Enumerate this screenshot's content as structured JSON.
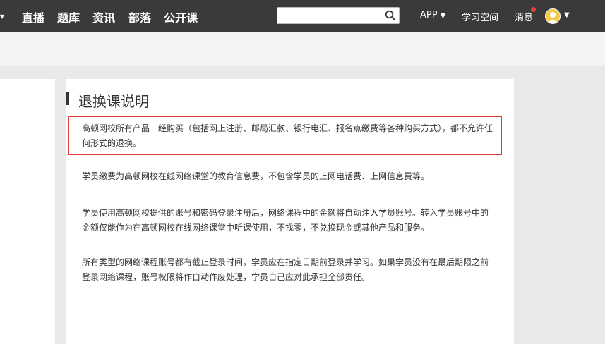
{
  "nav": {
    "items": [
      "直播",
      "题库",
      "资讯",
      "部落",
      "公开课"
    ],
    "search_placeholder": "",
    "app_label": "APP",
    "study_space_label": "学习空间",
    "messages_label": "消息"
  },
  "article": {
    "title": "退换课说明",
    "paragraphs": [
      "高顿网校所有产品一经购买（包括网上注册、邮局汇款、银行电汇、报名点缴费等各种购买方式），都不允许任何形式的退换。",
      "学员缴费为高顿网校在线网络课堂的教育信息费，不包含学员的上网电话费、上网信息费等。",
      "学员使用高顿网校提供的账号和密码登录注册后，网络课程中的金额将自动注入学员账号。转入学员账号中的金额仅能作为在高顿网校在线网络课堂中听课使用，不找零，不兑换现金或其他产品和服务。",
      "所有类型的网络课程账号都有截止登录时间，学员应在指定日期前登录并学习。如果学员没有在最后期限之前登录网络课程，账号权限将作自动作废处理，学员自己应对此承担全部责任。"
    ]
  },
  "colors": {
    "topbar": "#3a3a3a",
    "highlight": "#e23c3c",
    "badge": "#e63b3b"
  }
}
